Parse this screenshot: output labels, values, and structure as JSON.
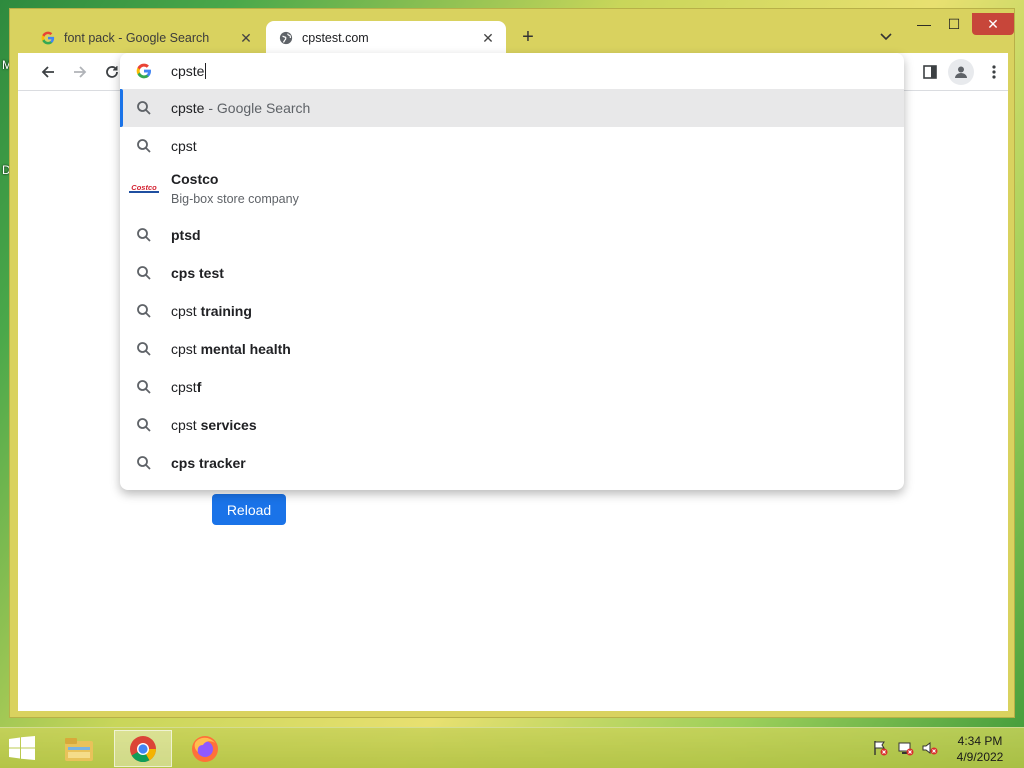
{
  "desktop": {
    "label_1": "M",
    "label_2": "D"
  },
  "browser": {
    "tabs": [
      {
        "title": "font pack - Google Search",
        "favicon": "google-g-icon",
        "active": false
      },
      {
        "title": "cpstest.com",
        "favicon": "globe-icon",
        "active": true
      }
    ],
    "newtab": "+",
    "window_controls": {
      "minimize": "—",
      "maximize": "☐",
      "close": "✕"
    }
  },
  "omnibox": {
    "input_value": "cpste",
    "suggestions": [
      {
        "type": "search",
        "plain": "cpste",
        "bold": "",
        "suffix": " - Google Search",
        "selected": true
      },
      {
        "type": "search",
        "plain": "cpst",
        "bold": "",
        "suffix": ""
      },
      {
        "type": "entity",
        "title": "Costco",
        "subtitle": "Big-box store company",
        "logo_text": "COSTCO"
      },
      {
        "type": "search",
        "plain": "",
        "bold": "ptsd",
        "suffix": ""
      },
      {
        "type": "search",
        "plain": "",
        "bold": "cps test",
        "suffix": ""
      },
      {
        "type": "search",
        "plain": "cpst ",
        "bold": "training",
        "suffix": ""
      },
      {
        "type": "search",
        "plain": "cpst ",
        "bold": "mental health",
        "suffix": ""
      },
      {
        "type": "search",
        "plain": "cpst",
        "bold": "f",
        "suffix": ""
      },
      {
        "type": "search",
        "plain": "cpst ",
        "bold": "services",
        "suffix": ""
      },
      {
        "type": "search",
        "plain": "",
        "bold": "cps tracker",
        "suffix": ""
      }
    ]
  },
  "page": {
    "reload_label": "Reload"
  },
  "taskbar": {
    "apps": [
      "file-explorer-icon",
      "chrome-icon",
      "firefox-icon"
    ],
    "clock_time": "4:34 PM",
    "clock_date": "4/9/2022"
  },
  "colors": {
    "accent": "#1a73e8",
    "selected_row": "#e8e8e9",
    "window_frame": "#d9d25f"
  }
}
